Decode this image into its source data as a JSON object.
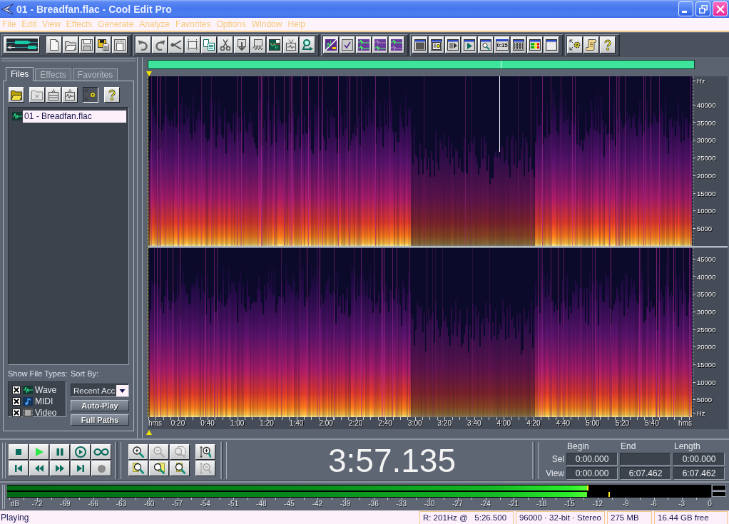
{
  "window": {
    "title": "01 - Breadfan.flac - Cool Edit Pro"
  },
  "menu": [
    "File",
    "Edit",
    "View",
    "Effects",
    "Generate",
    "Analyze",
    "Favorites",
    "Options",
    "Window",
    "Help"
  ],
  "toolbar": {
    "time_button_label": "0:15"
  },
  "organizer": {
    "tabs": [
      {
        "label": "Files",
        "selected": true
      },
      {
        "label": "Effects",
        "selected": false
      },
      {
        "label": "Favorites",
        "selected": false
      }
    ],
    "tool_buttons": [
      {
        "pressed": false
      },
      {
        "pressed": false
      },
      {
        "pressed": false
      },
      {
        "pressed": false
      },
      {
        "pressed": true
      },
      {
        "pressed": false
      }
    ],
    "files": [
      {
        "name": "01 - Breadfan.flac",
        "selected": true
      }
    ],
    "show_file_types_label": "Show File Types:",
    "file_types": [
      {
        "label": "Wave",
        "checked": true
      },
      {
        "label": "MIDI",
        "checked": true
      },
      {
        "label": "Video",
        "checked": true
      }
    ],
    "sort_by_label": "Sort By:",
    "sort_by_value": "Recent Acc",
    "buttons": [
      "Auto-Play",
      "Full Paths"
    ]
  },
  "waveform": {
    "channels": [
      {
        "frequency_labels": [
          "Hz",
          "40000",
          "35000",
          "30000",
          "25000",
          "20000",
          "15000",
          "10000",
          "5000"
        ]
      },
      {
        "frequency_labels": [
          "45000",
          "40000",
          "35000",
          "30000",
          "25000",
          "20000",
          "15000",
          "10000",
          "5000",
          "Hz"
        ]
      }
    ],
    "time_labels": [
      "hms",
      "0:20",
      "0:40",
      "1:00",
      "1:20",
      "1:40",
      "2:00",
      "2:20",
      "2:40",
      "3:00",
      "3:20",
      "3:40",
      "4:00",
      "4:20",
      "4:40",
      "5:00",
      "5:20",
      "5:40",
      "hms"
    ]
  },
  "transport": {
    "playing": true
  },
  "zoom_buttons": [
    {
      "disabled": false
    },
    {
      "disabled": true
    },
    {
      "disabled": true
    },
    {
      "disabled": false
    },
    {
      "disabled": false
    },
    {
      "disabled": false
    },
    {
      "disabled": false
    },
    {
      "disabled": true
    }
  ],
  "time_display": "3:57.135",
  "selection": {
    "headers": [
      "Begin",
      "End",
      "Length"
    ],
    "rows": [
      {
        "label": "Sel",
        "begin": "0:00.000",
        "length": "0:00.000"
      },
      {
        "label": "View",
        "begin": "0:00.000",
        "end": "6:07.462",
        "length": "6:07.462"
      }
    ]
  },
  "level_meter": {
    "channels": [
      {
        "level": 0.826,
        "peak_hold": {
          "level": 0.826
        }
      },
      {
        "level": 0.824,
        "peak_hold": {
          "level": 0.856
        }
      }
    ],
    "scale_labels": [
      "dB",
      "-72",
      "-69",
      "-66",
      "-63",
      "-60",
      "-57",
      "-54",
      "-51",
      "-48",
      "-45",
      "-42",
      "-39",
      "-36",
      "-33",
      "-30",
      "-27",
      "-24",
      "-21",
      "-18",
      "-15",
      "-12",
      "-9",
      "-6",
      "-3",
      "0"
    ]
  },
  "status_bar": {
    "state": "Playing",
    "cursor_info": "R: 201Hz @   5:26.500",
    "format": "96000 · 32-bit · Stereo",
    "size": "275 MB",
    "free_space": "16.44 GB free"
  }
}
